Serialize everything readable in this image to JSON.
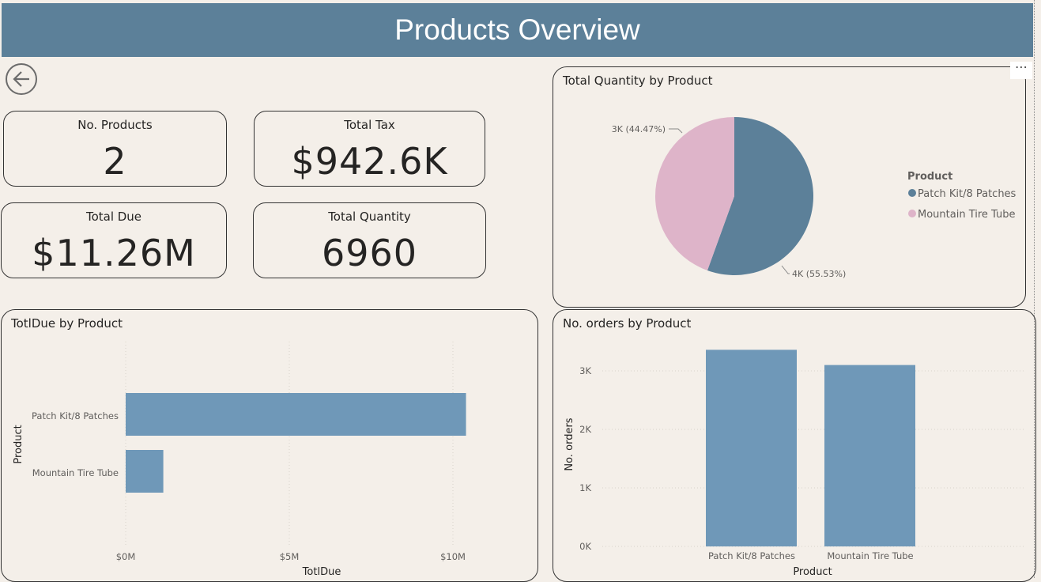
{
  "header": {
    "title": "Products Overview"
  },
  "cards": [
    {
      "label": "No. Products",
      "value": "2"
    },
    {
      "label": "Total Tax",
      "value": "$942.6K"
    },
    {
      "label": "Total Due",
      "value": "$11.26M"
    },
    {
      "label": "Total Quantity",
      "value": "6960"
    }
  ],
  "colors": {
    "series_blue": "#5c8099",
    "bar_blue": "#6f98b8",
    "pink": "#deb4c9",
    "header": "#5c8099"
  },
  "pie": {
    "title": "Total Quantity by Product",
    "legend_title": "Product",
    "legend": [
      "Patch Kit/8 Patches",
      "Mountain Tire Tube"
    ],
    "labels": [
      "3K (44.47%)",
      "4K (55.53%)"
    ]
  },
  "bar_h": {
    "title": "TotlDue by Product",
    "ylabel": "Product",
    "xlabel": "TotlDue",
    "categories": [
      "Patch Kit/8 Patches",
      "Mountain Tire Tube"
    ],
    "ticks": [
      "$0M",
      "$5M",
      "$10M"
    ]
  },
  "bar_v": {
    "title": "No. orders by Product",
    "ylabel": "No. orders",
    "xlabel": "Product",
    "categories": [
      "Patch Kit/8 Patches",
      "Mountain Tire Tube"
    ],
    "ticks": [
      "0K",
      "1K",
      "2K",
      "3K"
    ]
  },
  "chart_data": [
    {
      "type": "pie",
      "title": "Total Quantity by Product",
      "categories": [
        "Patch Kit/8 Patches",
        "Mountain Tire Tube"
      ],
      "values": [
        3865,
        3095
      ],
      "percent": [
        55.53,
        44.47
      ],
      "legend": "right"
    },
    {
      "type": "bar",
      "orientation": "horizontal",
      "title": "TotlDue by Product",
      "categories": [
        "Patch Kit/8 Patches",
        "Mountain Tire Tube"
      ],
      "values": [
        10.4,
        1.15
      ],
      "xlabel": "TotlDue",
      "ylabel": "Product",
      "xlim": [
        0,
        10.5
      ]
    },
    {
      "type": "bar",
      "title": "No. orders by Product",
      "categories": [
        "Patch Kit/8 Patches",
        "Mountain Tire Tube"
      ],
      "values": [
        3360,
        3100
      ],
      "xlabel": "Product",
      "ylabel": "No. orders",
      "ylim": [
        0,
        3400
      ]
    }
  ]
}
